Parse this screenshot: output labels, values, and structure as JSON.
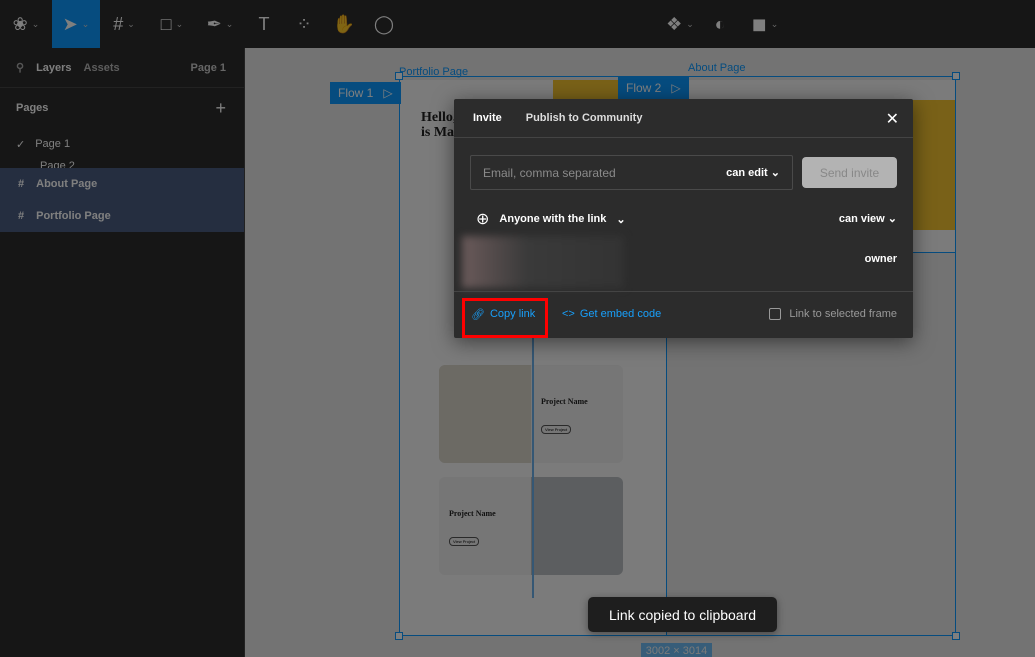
{
  "toolbar": {
    "tools": [
      "figma-menu",
      "move",
      "frame",
      "shape",
      "pen",
      "text",
      "resources",
      "hand",
      "comment"
    ],
    "right_tools": [
      "component",
      "mask",
      "boolean"
    ]
  },
  "panel": {
    "tab_layers": "Layers",
    "tab_assets": "Assets",
    "page_selector": "Page 1",
    "pages_heading": "Pages",
    "pages": [
      "Page 1",
      "Page 2"
    ],
    "layers": [
      "About Page",
      "Portfolio Page"
    ]
  },
  "canvas": {
    "frame_portfolio": "Portfolio Page",
    "frame_about": "About Page",
    "flow1": "Flow 1",
    "flow2": "Flow 2",
    "hero_line1": "Hello,",
    "hero_line2": "is Mad",
    "project1": "Project Name",
    "project2": "Project Name",
    "view_project": "View Project",
    "size_badge": "3002 × 3014"
  },
  "dialog": {
    "tab_invite": "Invite",
    "tab_publish": "Publish to Community",
    "email_placeholder": "Email, comma separated",
    "email_permission": "can edit",
    "send_invite": "Send invite",
    "link_access": "Anyone with the link",
    "link_permission": "can view",
    "owner_role": "owner",
    "copy_link": "Copy link",
    "embed_code": "Get embed code",
    "link_selected_frame": "Link to selected frame"
  },
  "toast": {
    "message": "Link copied to clipboard"
  },
  "colors": {
    "accent": "#0d99ff",
    "highlight": "#ff0000",
    "link": "#18a0fb"
  }
}
